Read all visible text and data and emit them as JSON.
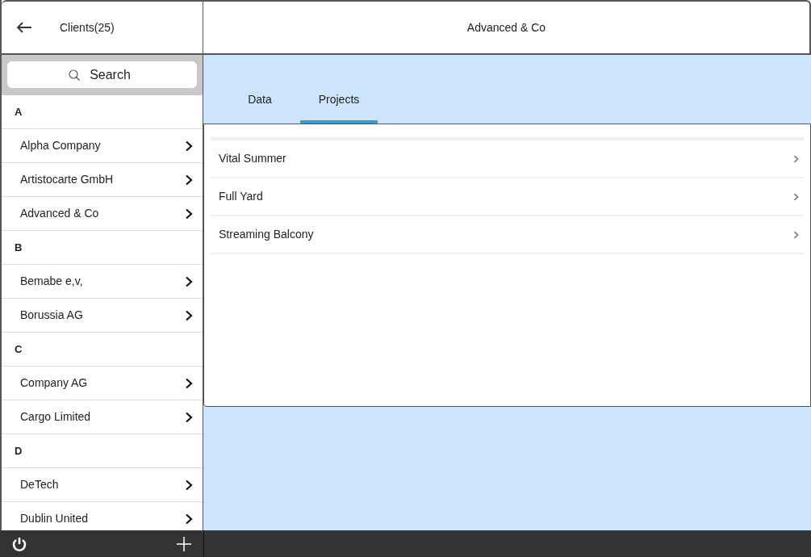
{
  "sidebar": {
    "title": "Clients(25)",
    "search": {
      "placeholder": "Search"
    },
    "groups": [
      {
        "letter": "A",
        "clients": [
          "Alpha Company",
          "Artistocarte GmbH",
          "Advanced & Co"
        ]
      },
      {
        "letter": "B",
        "clients": [
          "Bemabe e,v,",
          "Borussia AG"
        ]
      },
      {
        "letter": "C",
        "clients": [
          "Company AG",
          "Cargo Limited"
        ]
      },
      {
        "letter": "D",
        "clients": [
          "DeTech",
          "Dublin United"
        ]
      }
    ]
  },
  "detail": {
    "title": "Advanced & Co",
    "tabs": [
      {
        "label": "Data",
        "selected": false
      },
      {
        "label": "Projects",
        "selected": true
      }
    ],
    "projects": [
      "Vital Summer",
      "Full Yard",
      "Streaming Balcony"
    ]
  }
}
